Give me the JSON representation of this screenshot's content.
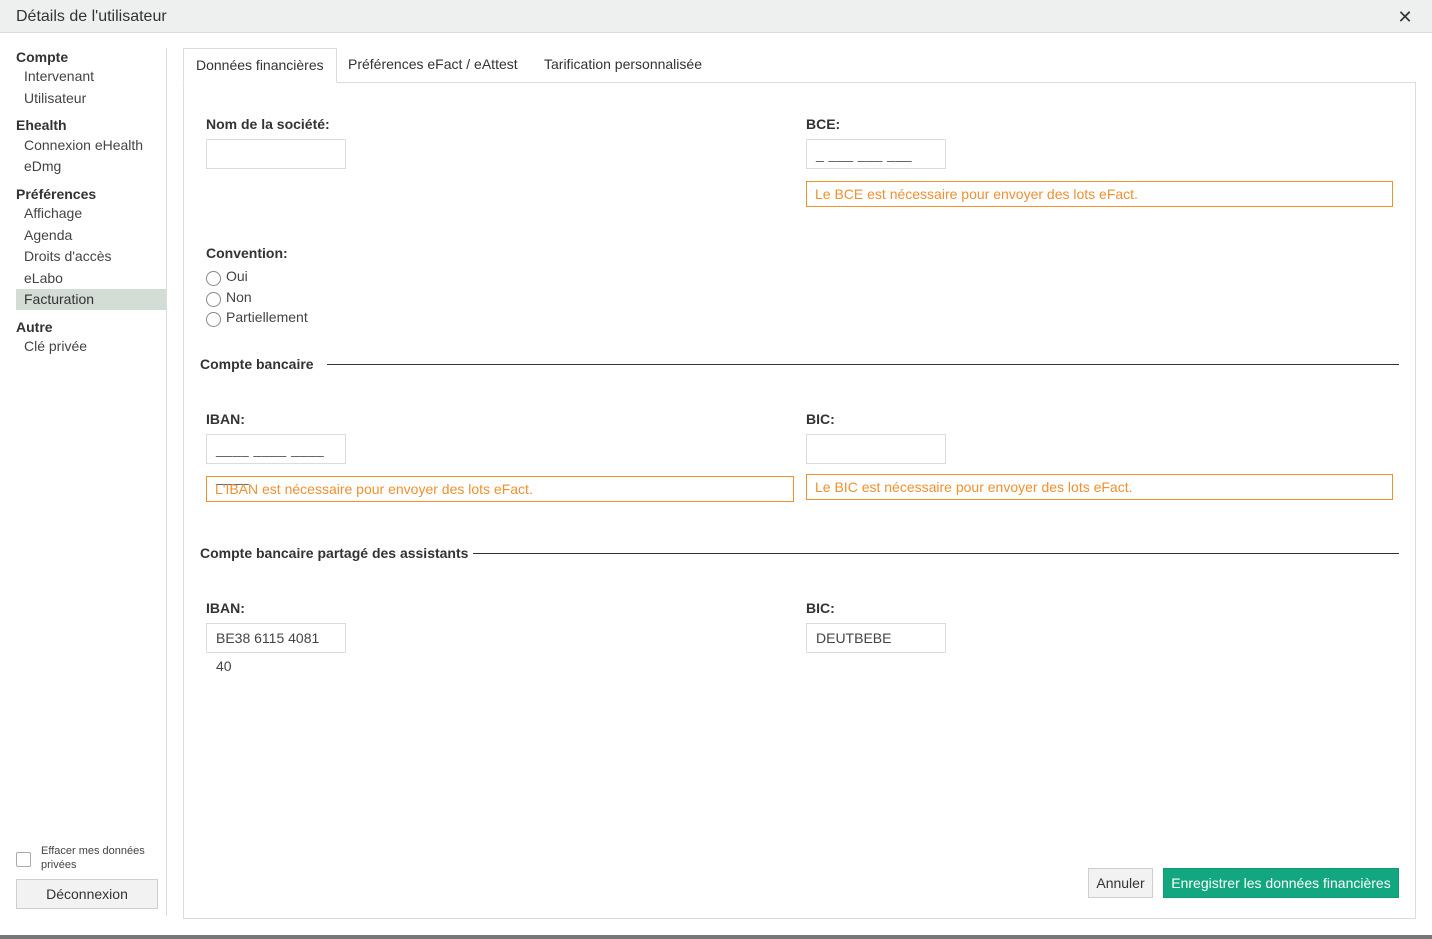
{
  "window": {
    "title": "Détails de l'utilisateur",
    "close_glyph": "✕"
  },
  "sidebar": {
    "groups": [
      {
        "label": "Compte",
        "items": [
          "Intervenant",
          "Utilisateur"
        ]
      },
      {
        "label": "Ehealth",
        "items": [
          "Connexion eHealth",
          "eDmg"
        ]
      },
      {
        "label": "Préférences",
        "items": [
          "Affichage",
          "Agenda",
          "Droits d'accès",
          "eLabo",
          "Facturation"
        ]
      },
      {
        "label": "Autre",
        "items": [
          "Clé privée"
        ]
      }
    ],
    "active_item": "Facturation",
    "erase_checkbox_label": "Effacer mes données privées",
    "logout_label": "Déconnexion"
  },
  "tabs": [
    "Données financières",
    "Préférences eFact / eAttest",
    "Tarification personnalisée"
  ],
  "active_tab": "Données financières",
  "form": {
    "company_name": {
      "label": "Nom de la société:",
      "value": ""
    },
    "bce": {
      "label": "BCE:",
      "mask": "_ ___ ___ ___",
      "warning": "Le BCE est nécessaire pour envoyer des lots eFact."
    },
    "convention": {
      "label": "Convention:",
      "options": [
        "Oui",
        "Non",
        "Partiellement"
      ],
      "selected": null
    },
    "bank_account": {
      "section_title": "Compte bancaire",
      "iban": {
        "label": "IBAN:",
        "mask": "____ ____ ____ ____",
        "warning": "L'IBAN est nécessaire pour envoyer des lots eFact."
      },
      "bic": {
        "label": "BIC:",
        "value": "",
        "warning": "Le BIC est nécessaire pour envoyer des lots eFact."
      }
    },
    "shared_bank_account": {
      "section_title": "Compte bancaire partagé des assistants",
      "iban": {
        "label": "IBAN:",
        "value": "BE38 6115 4081 40"
      },
      "bic": {
        "label": "BIC:",
        "value": "DEUTBEBE"
      }
    }
  },
  "buttons": {
    "cancel": "Annuler",
    "save": "Enregistrer les données financières"
  },
  "colors": {
    "warning": "#f0902e",
    "primary": "#12a77f",
    "active_sidebar": "#d4dcd6"
  }
}
